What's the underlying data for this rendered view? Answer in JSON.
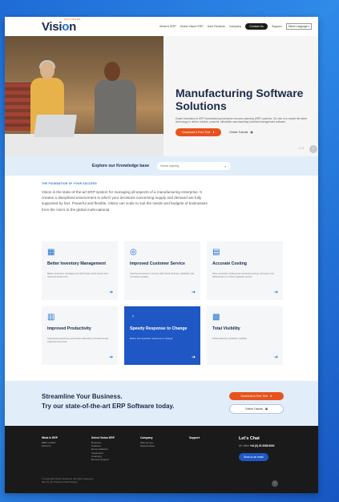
{
  "header": {
    "logo_tagline": "SOFTWARE",
    "logo_pre": "Visi",
    "logo_o": "o",
    "logo_post": "n",
    "nav": [
      "What is ERP",
      "Select Vision ERP",
      "User Reviews",
      "Company"
    ],
    "contact_label": "Contact Us",
    "support_label": "Support",
    "language_label": "Select Language ▾"
  },
  "hero": {
    "title": "Manufacturing Software Solutions",
    "description": "Expert innovators in ERP manufacturing enterprise resource planning (ERP) systems. Our aim is to exploit the latest technology to deliver reliable, powerful, affordable manufacturing business management software.",
    "primary_button": "Download a Free Trial",
    "secondary_button": "Online Tutorial",
    "pager": "1 / 4"
  },
  "knowledge": {
    "title": "Explore our Knowledge base",
    "search_placeholder": "Search anything"
  },
  "foundation": {
    "label": "THE FOUNDATION OF YOUR SUCCESS",
    "text": "Vision is the state-of-the-art ERP system for managing all aspects of a manufacturing enterprise. It creates a disciplined environment in which your decisions concerning supply and demand are fully supported by fact. Powerful and flexible, Vision can scale to suit the needs and budgets of businesses from the micro to the global multi-national."
  },
  "cards": [
    {
      "title": "Better Inventory Management",
      "desc": "Better inventory management with lower stock levels and reduced stock-outs",
      "icon": "box-icon"
    },
    {
      "title": "Improved Customer Service",
      "desc": "Improved customer service with better delivery reliability and consistent quality",
      "icon": "target-icon"
    },
    {
      "title": "Accurate Costing",
      "desc": "More accurate costing and accurate pricing. Increase cost efficiencies in a short payback period",
      "icon": "chart-icon"
    },
    {
      "title": "Improved Productivity",
      "desc": "Improved productivity and better allocation of internal and external resources",
      "icon": "calendar-icon"
    },
    {
      "title": "Speedy Response to Change",
      "desc": "Better and speedier response to change",
      "icon": "clock-icon"
    },
    {
      "title": "Total Visibility",
      "desc": "Total business condition visibility",
      "icon": "grid-icon"
    }
  ],
  "cta": {
    "line1": "Streamline Your Business.",
    "line2": "Try our state-of-the-art ERP Software today.",
    "primary_button": "Download a Free Trial",
    "secondary_button": "Online Tutorial"
  },
  "footer": {
    "col1": {
      "items": [
        "What is ERP",
        "MRP vs ERP",
        "Partners"
      ]
    },
    "col2": {
      "heading": "Select Vision ERP",
      "items": [
        "Brochure",
        "Features",
        "Demo Software",
        "Investment",
        "Licensing",
        "Remote Support"
      ]
    },
    "col3": {
      "heading": "Company",
      "items": [
        "Who we are",
        "Opportunities"
      ]
    },
    "col4": {
      "heading": "Support"
    },
    "chat": {
      "title": "Let's Chat",
      "office_label": "UK office",
      "phone": "+44 (0) 20 3598 8000",
      "button": "Send us an email"
    },
    "copyright_1": "© Copyright Vision Solutions. All rights reserved.",
    "copyright_2": "Site by the Preferred Web Design"
  },
  "colors": {
    "accent": "#1c6fd1",
    "orange": "#e8531d",
    "navy": "#1c2a4a",
    "footer": "#1a1a1a"
  }
}
